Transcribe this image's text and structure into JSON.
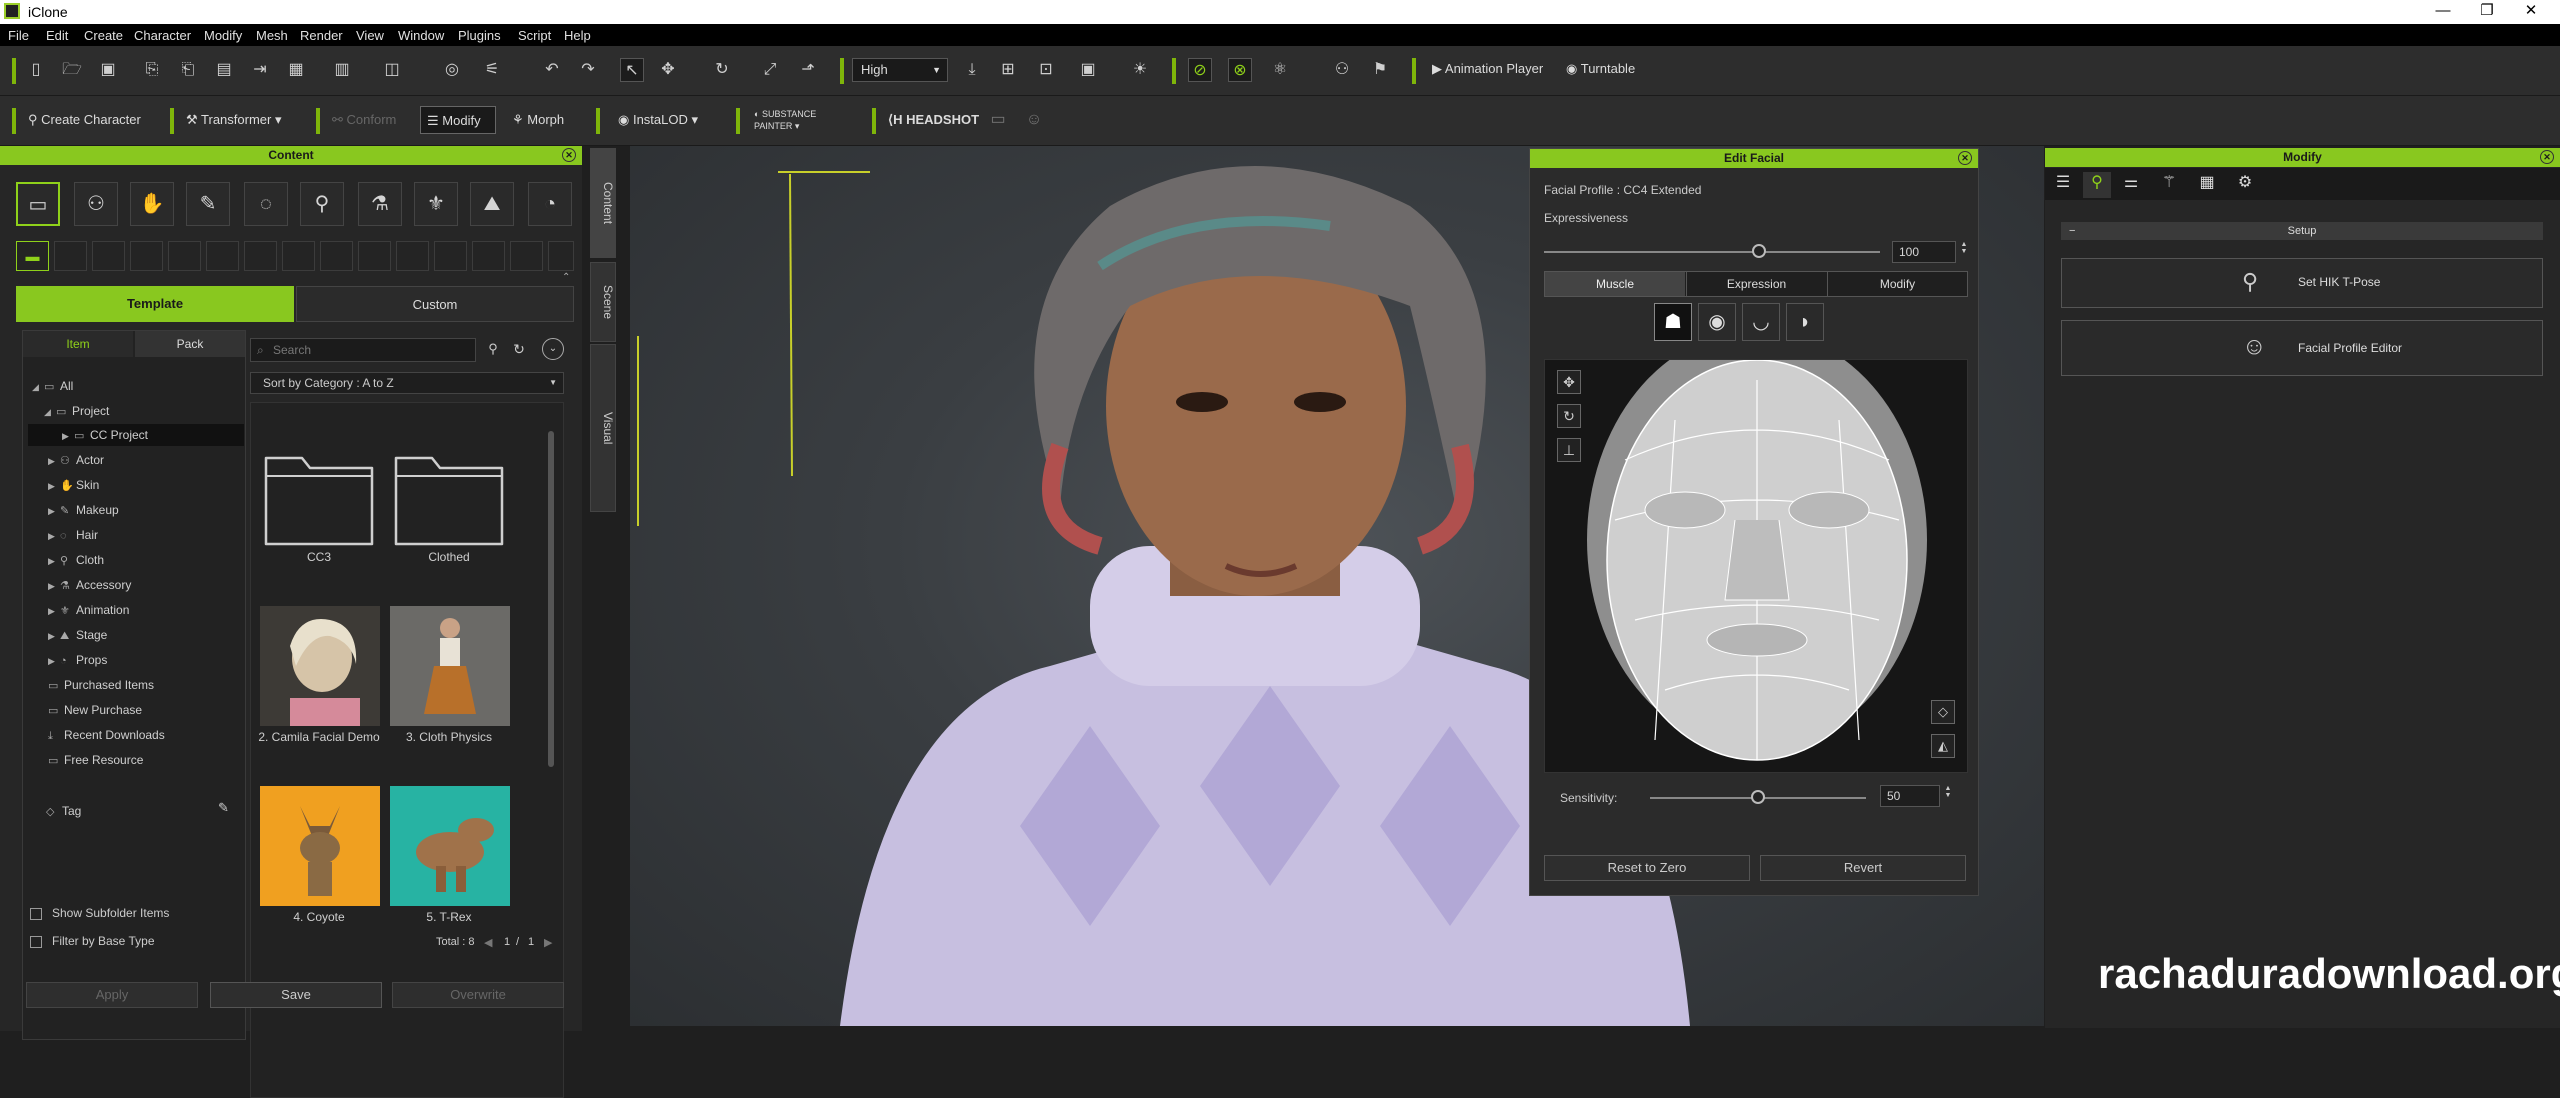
{
  "window": {
    "title": "iClone"
  },
  "menu": [
    "File",
    "Edit",
    "Create",
    "Character",
    "Modify",
    "Mesh",
    "Render",
    "View",
    "Window",
    "Plugins",
    "Script",
    "Help"
  ],
  "toolbar1": {
    "quality": "High",
    "animation_player": "Animation Player",
    "turntable": "Turntable"
  },
  "toolbar2": {
    "create_character": "Create Character",
    "transformer": "Transformer",
    "conform": "Conform",
    "modify": "Modify",
    "morph": "Morph",
    "instalod": "InstaLOD",
    "substance": "SUBSTANCE PAINTER",
    "headshot": "HEADSHOT"
  },
  "content": {
    "title": "Content",
    "tabs": [
      "Template",
      "Custom"
    ],
    "subtabs": [
      "Item",
      "Pack"
    ],
    "search_placeholder": "Search",
    "sort": "Sort by Category : A to Z",
    "tree": [
      "All",
      "Project",
      "CC Project",
      "Actor",
      "Skin",
      "Makeup",
      "Hair",
      "Cloth",
      "Accessory",
      "Animation",
      "Stage",
      "Props",
      "Purchased Items",
      "New Purchase",
      "Recent Downloads",
      "Free Resource"
    ],
    "tag": "Tag",
    "items": [
      "CC3",
      "Clothed",
      "2. Camila Facial Demo",
      "3. Cloth Physics",
      "4. Coyote",
      "5. T-Rex"
    ],
    "show_subfolder": "Show Subfolder Items",
    "filter_base": "Filter by Base Type",
    "total": "Total : 8",
    "page": "1",
    "pages": "1",
    "apply": "Apply",
    "save": "Save",
    "overwrite": "Overwrite"
  },
  "side_tabs": [
    "Content",
    "Scene",
    "Visual"
  ],
  "edit_facial": {
    "title": "Edit Facial",
    "profile_label": "Facial Profile :",
    "profile_value": "CC4 Extended",
    "expressiveness_label": "Expressiveness",
    "expressiveness_value": "100",
    "expressiveness": 1.0,
    "tabs": [
      "Muscle",
      "Expression",
      "Modify"
    ],
    "sensitivity_label": "Sensitivity:",
    "sensitivity_value": "50",
    "sensitivity": 0.5,
    "reset": "Reset to Zero",
    "revert": "Revert"
  },
  "modify": {
    "title": "Modify",
    "setup": "Setup",
    "hik": "Set HIK T-Pose",
    "facial_profile_editor": "Facial Profile Editor"
  },
  "watermark": "rachaduradownload.org"
}
